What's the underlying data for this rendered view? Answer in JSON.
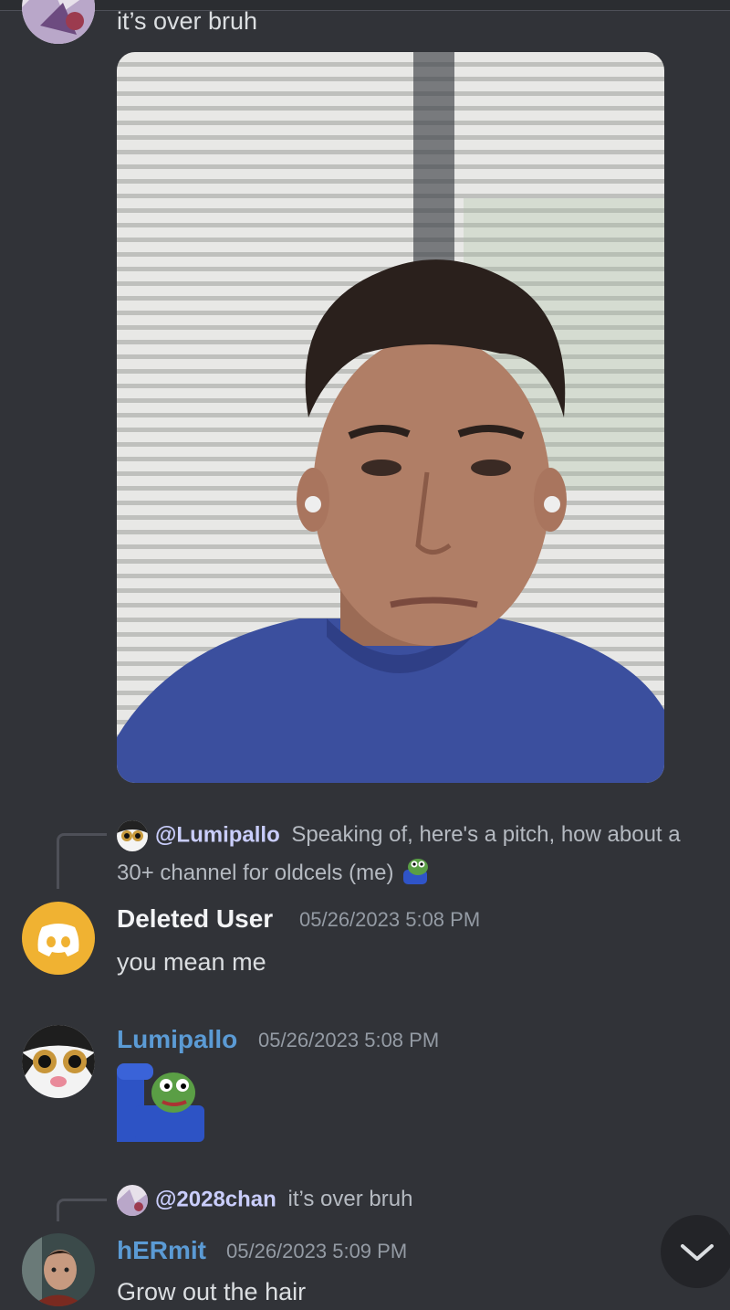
{
  "messages": [
    {
      "text": "it’s over bruh"
    },
    {
      "reply": {
        "mention": "@Lumipallo",
        "text": "Speaking of, here's a pitch, how about a",
        "text2": "30+ channel for oldcels (me)"
      },
      "username": "Deleted User",
      "username_color": "#f2f3f5",
      "timestamp": "05/26/2023 5:08 PM",
      "text": "you mean me"
    },
    {
      "username": "Lumipallo",
      "username_color": "#5b9bd5",
      "timestamp": "05/26/2023 5:08 PM"
    },
    {
      "reply": {
        "mention": "@2028chan",
        "text": "it’s over bruh"
      },
      "username": "hERmit",
      "username_color": "#5b9bd5",
      "timestamp": "05/26/2023 5:09 PM",
      "text": "Grow out the hair"
    }
  ],
  "icons": {
    "scroll": "chevron-down-icon",
    "discord": "discord-logo-icon"
  },
  "colors": {
    "background": "#313338",
    "discord_avatar": "#f0b232",
    "link_name": "#5b9bd5"
  }
}
